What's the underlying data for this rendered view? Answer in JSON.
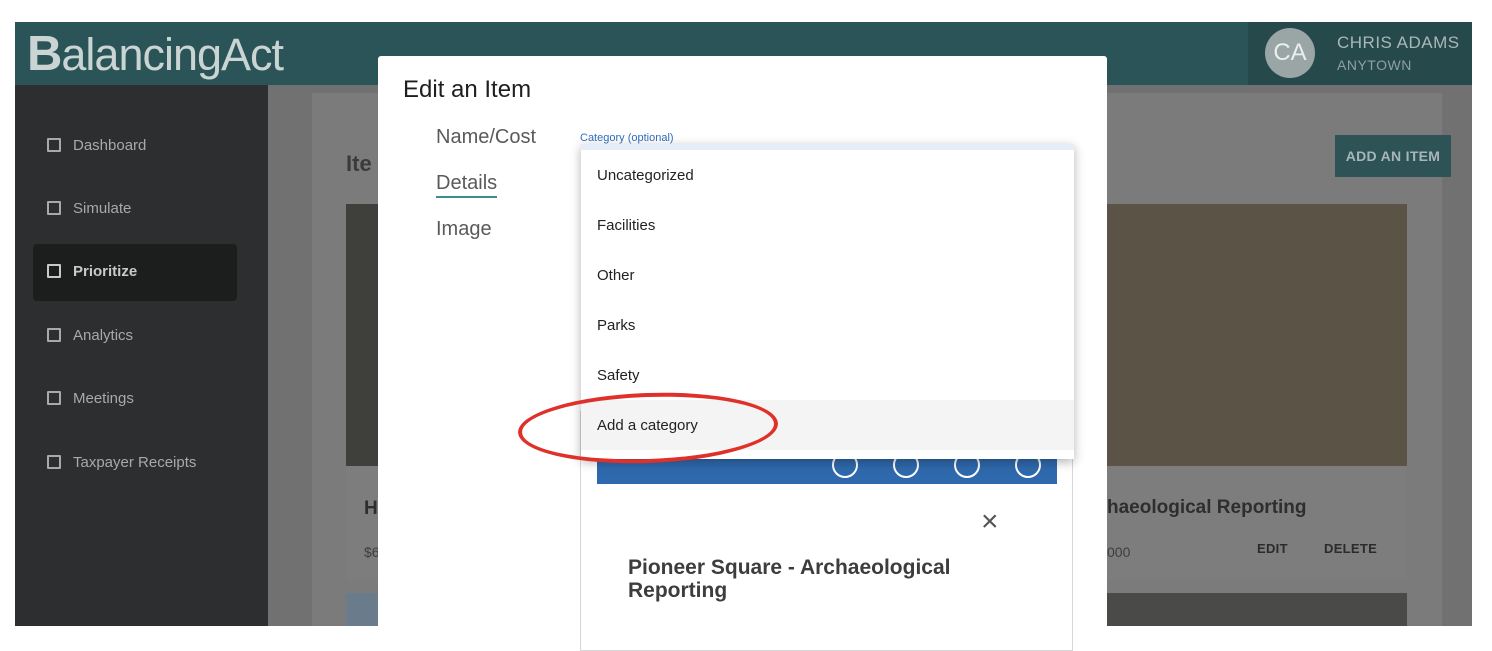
{
  "header": {
    "logo_b": "B",
    "logo_rest": "alancingAct",
    "avatar_initials": "CA",
    "user_name": "CHRIS ADAMS",
    "user_town": "ANYTOWN"
  },
  "sidebar": {
    "items": [
      {
        "label": "Dashboard",
        "icon": "dashboard-icon"
      },
      {
        "label": "Simulate",
        "icon": "simulate-icon"
      },
      {
        "label": "Prioritize",
        "icon": "prioritize-icon",
        "active": true
      },
      {
        "label": "Analytics",
        "icon": "analytics-icon"
      },
      {
        "label": "Meetings",
        "icon": "meetings-icon"
      },
      {
        "label": "Taxpayer Receipts",
        "icon": "receipt-icon"
      }
    ]
  },
  "main": {
    "items_title": "Ite",
    "add_item_label": "ADD AN ITEM",
    "cards": [
      {
        "title": "H",
        "cost": "$6"
      },
      {
        "title": "haeological Reporting",
        "cost": "000",
        "edit": "EDIT",
        "delete": "DELETE"
      }
    ]
  },
  "modal": {
    "title": "Edit an Item",
    "nav": [
      "Name/Cost",
      "Details",
      "Image"
    ],
    "selected_nav": "Details",
    "category_label": "Category (optional)",
    "dropdown_options": [
      "Uncategorized",
      "Facilities",
      "Other",
      "Parks",
      "Safety",
      "Add a category"
    ],
    "highlighted_option": "Add a category",
    "preview": {
      "close_glyph": "×",
      "title": "Pioneer Square - Archaeological Reporting"
    }
  },
  "colors": {
    "header": "#2a5457",
    "accent": "#3d8c8f",
    "annotation": "#e0302a"
  }
}
